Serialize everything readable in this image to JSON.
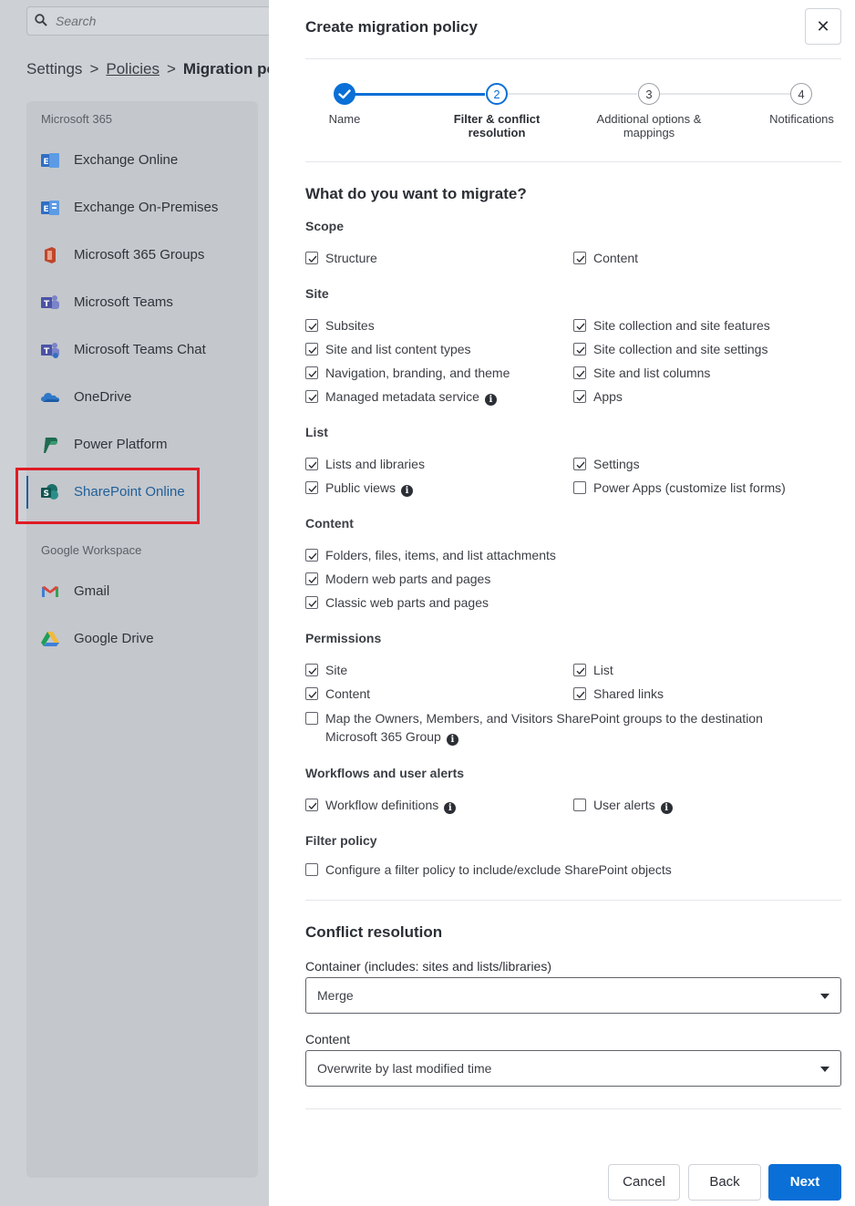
{
  "app": {
    "search": {
      "placeholder": "Search"
    },
    "breadcrumb": {
      "root": "Settings",
      "parent": "Policies",
      "current": "Migration pol"
    },
    "sidebar": {
      "groups": [
        {
          "label": "Microsoft 365"
        },
        {
          "label": "Google Workspace"
        }
      ],
      "items": [
        {
          "label": "Exchange Online",
          "icon": "exchange-online-icon"
        },
        {
          "label": "Exchange On-Premises",
          "icon": "exchange-onprem-icon"
        },
        {
          "label": "Microsoft 365 Groups",
          "icon": "office-groups-icon"
        },
        {
          "label": "Microsoft Teams",
          "icon": "teams-icon"
        },
        {
          "label": "Microsoft Teams Chat",
          "icon": "teams-chat-icon"
        },
        {
          "label": "OneDrive",
          "icon": "onedrive-icon"
        },
        {
          "label": "Power Platform",
          "icon": "power-platform-icon"
        },
        {
          "label": "SharePoint Online",
          "icon": "sharepoint-icon",
          "active": true
        },
        {
          "label": "Gmail",
          "icon": "gmail-icon"
        },
        {
          "label": "Google Drive",
          "icon": "google-drive-icon"
        }
      ]
    }
  },
  "panel": {
    "title": "Create migration policy",
    "close_symbol": "✕",
    "steps": [
      {
        "num": "1",
        "label": "Name",
        "state": "done"
      },
      {
        "num": "2",
        "label": "Filter & conflict resolution",
        "state": "active"
      },
      {
        "num": "3",
        "label": "Additional options & mappings",
        "state": "pending"
      },
      {
        "num": "4",
        "label": "Notifications",
        "state": "pending"
      }
    ],
    "migrate_heading": "What do you want to migrate?",
    "sections": {
      "scope": {
        "title": "Scope",
        "options": [
          {
            "label": "Structure",
            "checked": true
          },
          {
            "label": "Content",
            "checked": true
          }
        ]
      },
      "site": {
        "title": "Site",
        "options": [
          {
            "label": "Subsites",
            "checked": true
          },
          {
            "label": "Site collection and site features",
            "checked": true
          },
          {
            "label": "Site and list content types",
            "checked": true
          },
          {
            "label": "Site collection and site settings",
            "checked": true
          },
          {
            "label": "Navigation, branding, and theme",
            "checked": true
          },
          {
            "label": "Site and list columns",
            "checked": true
          },
          {
            "label": "Managed metadata service",
            "checked": true,
            "info": true
          },
          {
            "label": "Apps",
            "checked": true
          }
        ]
      },
      "list": {
        "title": "List",
        "options": [
          {
            "label": "Lists and libraries",
            "checked": true
          },
          {
            "label": "Settings",
            "checked": true
          },
          {
            "label": "Public views",
            "checked": true,
            "info": true
          },
          {
            "label": "Power Apps (customize list forms)",
            "checked": false
          }
        ]
      },
      "content": {
        "title": "Content",
        "options": [
          {
            "label": "Folders, files, items, and list attachments",
            "checked": true
          },
          {
            "label": "Modern web parts and pages",
            "checked": true
          },
          {
            "label": "Classic web parts and pages",
            "checked": true
          }
        ]
      },
      "permissions": {
        "title": "Permissions",
        "options": [
          {
            "label": "Site",
            "checked": true
          },
          {
            "label": "List",
            "checked": true
          },
          {
            "label": "Content",
            "checked": true
          },
          {
            "label": "Shared links",
            "checked": true
          },
          {
            "label": "Map the Owners, Members, and Visitors SharePoint groups to the destination Microsoft 365 Group",
            "checked": false,
            "info": true
          }
        ]
      },
      "workflows": {
        "title": "Workflows and user alerts",
        "options": [
          {
            "label": "Workflow definitions",
            "checked": true,
            "info": true
          },
          {
            "label": "User alerts",
            "checked": false,
            "info": true
          }
        ]
      },
      "filter": {
        "title": "Filter policy",
        "options": [
          {
            "label": "Configure a filter policy to include/exclude SharePoint objects",
            "checked": false
          }
        ]
      }
    },
    "conflict": {
      "heading": "Conflict resolution",
      "container_label": "Container (includes: sites and lists/libraries)",
      "container_value": "Merge",
      "content_label": "Content",
      "content_value": "Overwrite by last modified time"
    },
    "buttons": {
      "cancel": "Cancel",
      "back": "Back",
      "next": "Next"
    }
  },
  "colors": {
    "primary": "#0a6fd6",
    "step_active": "#0a6fd6",
    "highlight_box": "#e01b24"
  }
}
